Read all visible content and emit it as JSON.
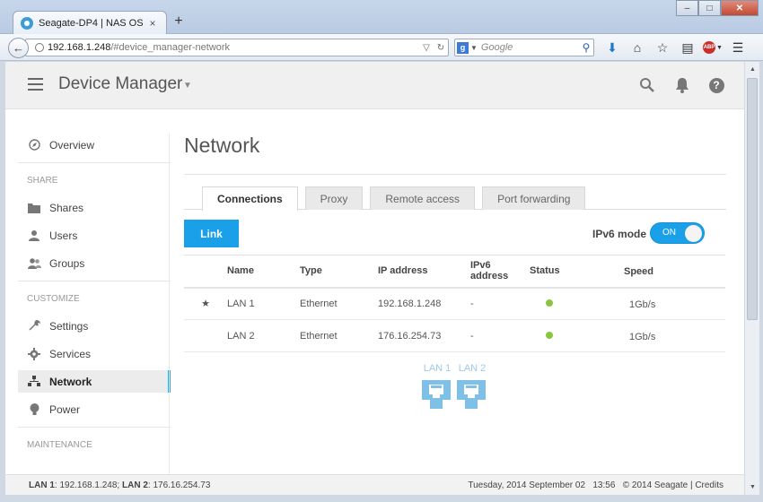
{
  "browser": {
    "tab_title": "Seagate-DP4 | NAS OS",
    "tab_close": "×",
    "new_tab": "+",
    "win_minimize": "–",
    "win_maximize": "□",
    "win_close": "✕",
    "url_host": "192.168.1.248",
    "url_path": "/#device_manager-network",
    "search_engine_badge": "g",
    "search_placeholder": "Google"
  },
  "header": {
    "title": "Device Manager"
  },
  "sidebar": {
    "overview": "Overview",
    "share_section": "SHARE",
    "share_items": [
      "Shares",
      "Users",
      "Groups"
    ],
    "customize_section": "CUSTOMIZE",
    "customize_items": [
      "Settings",
      "Services",
      "Network",
      "Power"
    ],
    "maintenance_section": "MAINTENANCE"
  },
  "main": {
    "title": "Network",
    "tabs": [
      "Connections",
      "Proxy",
      "Remote access",
      "Port forwarding"
    ],
    "active_tab": "Connections",
    "link_button": "Link",
    "ipv6_label": "IPv6 mode",
    "ipv6_toggle": "ON",
    "table": {
      "columns": [
        "Name",
        "Type",
        "IP address",
        "IPv6 address",
        "Status",
        "Speed"
      ],
      "rows": [
        {
          "name": "LAN 1",
          "type": "Ethernet",
          "ip": "192.168.1.248",
          "ipv6": "-",
          "speed": "1Gb/s",
          "primary": true
        },
        {
          "name": "LAN 2",
          "type": "Ethernet",
          "ip": "176.16.254.73",
          "ipv6": "-",
          "speed": "1Gb/s",
          "primary": false
        }
      ]
    },
    "ports": [
      "LAN 1",
      "LAN 2"
    ]
  },
  "status_bar": {
    "lan1_label": "LAN 1",
    "lan1_value": ": 192.168.1.248; ",
    "lan2_label": "LAN 2",
    "lan2_value": ": 176.16.254.73",
    "date": "Tuesday, 2014 September 02",
    "time": "13:56",
    "copyright": "© 2014 Seagate | Credits"
  },
  "colors": {
    "accent": "#1aa0e8",
    "status_ok": "#8bc43f"
  }
}
